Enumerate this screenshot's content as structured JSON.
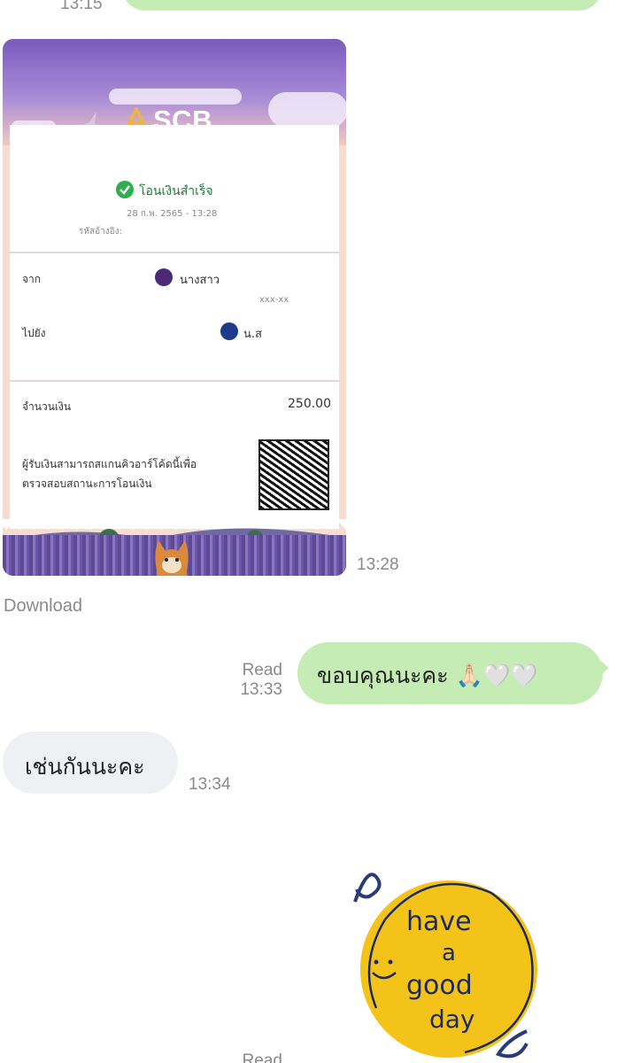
{
  "messages": {
    "top": {
      "time": "13:15"
    },
    "receipt": {
      "time": "13:28",
      "download_label": "Download",
      "bank_name": "SCB",
      "status": "โอนเงินสำเร็จ",
      "datetime": "28 ก.พ. 2565 - 13:28",
      "ref_label": "รหัสอ้างอิง:",
      "from_label": "จาก",
      "from_name": "นางสาว",
      "from_account": "xxx-xx",
      "to_label": "ไปยัง",
      "to_name": "น.ส",
      "amount_label": "จำนวนเงิน",
      "amount_value": "250.00",
      "qr_note_line1": "ผู้รับเงินสามารถสแกนคิวอาร์โค้ดนี้เพื่อ",
      "qr_note_line2": "ตรวจสอบสถานะการโอนเงิน"
    },
    "thanks": {
      "status": "Read",
      "time": "13:33",
      "text": "ขอบคุณนะคะ 🙏🏻🤍🤍"
    },
    "reply": {
      "text": "เช่นกันนะคะ",
      "time": "13:34"
    },
    "sticker": {
      "status": "Read",
      "lines": [
        "have",
        "a",
        "good",
        "day"
      ],
      "circle_color": "#f4c319"
    }
  },
  "colors": {
    "outgoing_bubble": "#c6ecb6",
    "incoming_bubble": "#eef0f3",
    "timestamp": "#8a8a8a",
    "scb_purple": "#5a3a8e"
  }
}
